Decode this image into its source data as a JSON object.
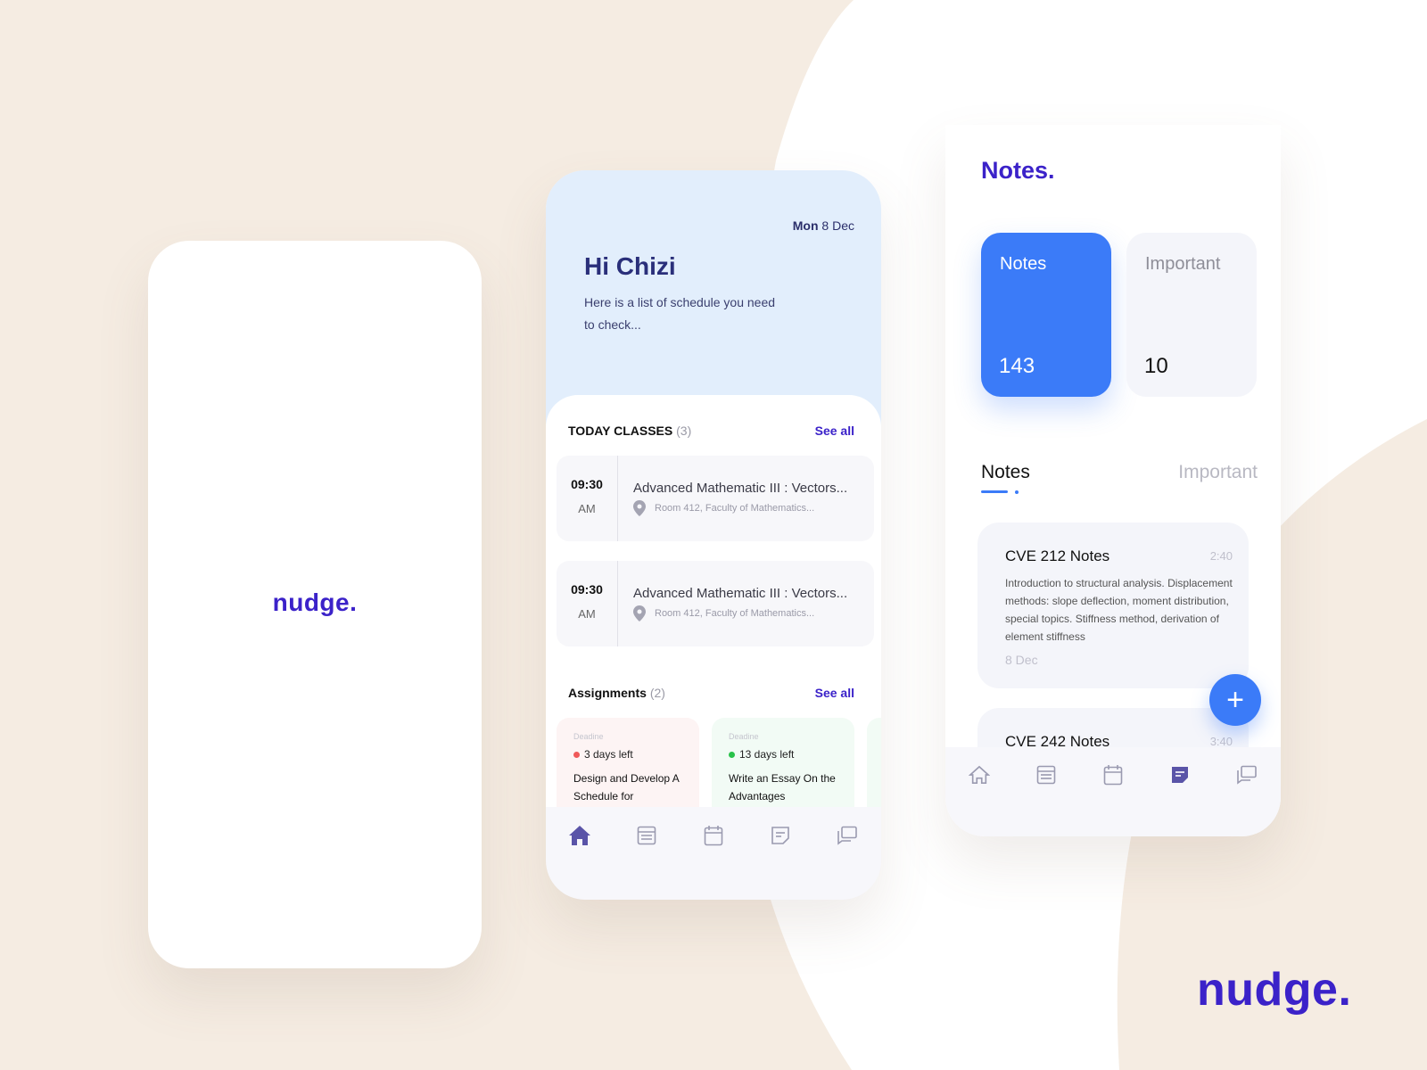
{
  "brand": {
    "logo": "nudge.",
    "color": "#3b22c9"
  },
  "splash": {
    "logo": "nudge."
  },
  "home": {
    "date_day": "Mon",
    "date_rest": "8 Dec",
    "greeting": "Hi Chizi",
    "subtitle": "Here is a list of schedule you need to check...",
    "classes": {
      "title": "TODAY CLASSES",
      "count": "(3)",
      "see_all": "See all",
      "items": [
        {
          "time": "09:30",
          "ampm": "AM",
          "title": "Advanced Mathematic III : Vectors...",
          "location": "Room 412, Faculty of Mathematics..."
        },
        {
          "time": "09:30",
          "ampm": "AM",
          "title": "Advanced Mathematic III : Vectors...",
          "location": "Room 412, Faculty of Mathematics..."
        }
      ]
    },
    "assignments": {
      "title": "Assignments",
      "count": "(2)",
      "see_all": "See all",
      "items": [
        {
          "deadline_label": "Deadine",
          "left": "3 days left",
          "task": "Design and Develop A Schedule for",
          "status_color": "#f05a5a"
        },
        {
          "deadline_label": "Deadine",
          "left": "13 days left",
          "task": "Write an Essay On the Advantages",
          "status_color": "#29c24a"
        }
      ]
    },
    "nav": [
      "home-icon",
      "list-icon",
      "calendar-icon",
      "notes-icon",
      "chat-icon"
    ],
    "active_nav": "home-icon"
  },
  "notes": {
    "title": "Notes.",
    "stats": [
      {
        "label": "Notes",
        "value": "143"
      },
      {
        "label": "Important",
        "value": "10"
      }
    ],
    "tabs": [
      "Notes",
      "Important"
    ],
    "cards": [
      {
        "title": "CVE 212 Notes",
        "time": "2:40",
        "body": "Introduction to structural analysis. Displacement methods: slope deflection, moment distribution, special topics. Stiffness method, derivation of element stiffness",
        "date": "8 Dec"
      },
      {
        "title": "CVE 242 Notes",
        "time": "3:40"
      }
    ],
    "fab": "+",
    "active_nav": "notes-icon"
  }
}
